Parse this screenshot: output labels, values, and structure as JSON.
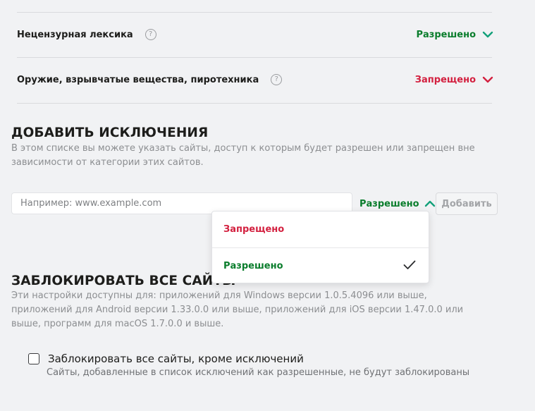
{
  "categories": [
    {
      "label": "Нецензурная лексика",
      "status": "Разрешено",
      "state": "allowed"
    },
    {
      "label": "Оружие, взрывчатые вещества, пиротехника",
      "status": "Запрещено",
      "state": "denied"
    }
  ],
  "help_icon": {
    "glyph": "?",
    "name": "question-circle-icon"
  },
  "exceptions": {
    "title": "ДОБАВИТЬ ИСКЛЮЧЕНИЯ",
    "description": "В этом списке вы можете указать сайты, доступ к которым будет разрешен или запрещен вне зависимости от категории этих сайтов.",
    "input": {
      "placeholder": "Например: www.example.com",
      "value": ""
    },
    "select": {
      "selected": "Разрешено",
      "expanded": true,
      "options": [
        {
          "label": "Запрещено",
          "state": "denied",
          "checked": false
        },
        {
          "label": "Разрешено",
          "state": "allowed",
          "checked": true
        }
      ]
    },
    "add_button": "Добавить"
  },
  "block_all": {
    "title": "ЗАБЛОКИРОВАТЬ ВСЕ САЙТЫ",
    "description": "Эти настройки доступны для: приложений для Windows версии 1.0.5.4096 или выше, приложений для Android версии 1.33.0.0 или выше, приложений для iOS версии 1.47.0.0 или выше, программ для macOS 1.7.0.0 и выше.",
    "checkbox_label": "Заблокировать все сайты, кроме исключений",
    "checkbox_checked": false,
    "checkbox_hint": "Сайты, добавленные в список исключений как разрешенные, не будут заблокированы"
  },
  "colors": {
    "allowed": "#0a7d2c",
    "denied": "#d3203f",
    "chevron_allowed": "#13a07a",
    "chevron_denied": "#d3203f",
    "background": "#f1f2f4"
  }
}
